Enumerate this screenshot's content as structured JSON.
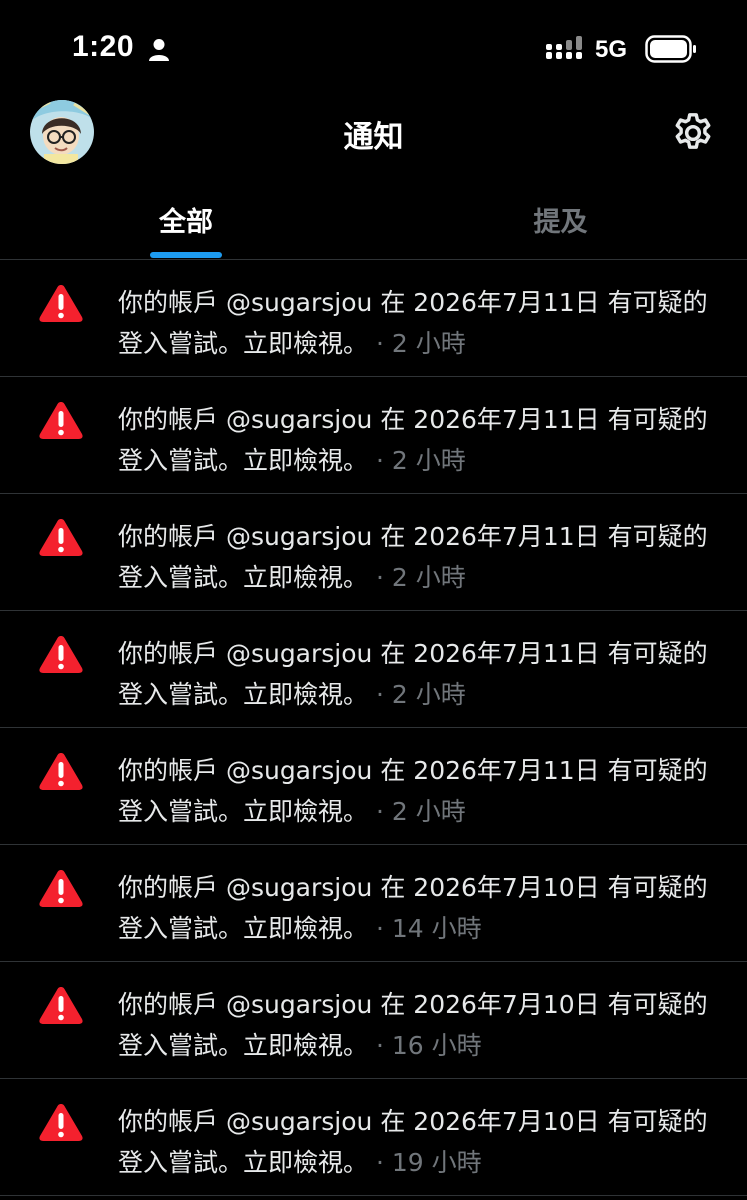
{
  "status_bar": {
    "time": "1:20",
    "network": "5G",
    "icons": [
      "person-icon",
      "signal-icon",
      "battery-icon"
    ]
  },
  "header": {
    "title": "通知",
    "avatar": "avatar",
    "settings_icon": "gear-icon"
  },
  "tabs": [
    {
      "label": "全部",
      "active": true
    },
    {
      "label": "提及",
      "active": false
    }
  ],
  "colors": {
    "background": "#000000",
    "accent": "#1d9bf0",
    "warning": "#f4212e",
    "muted": "#71767b",
    "divider": "#2f3336"
  },
  "notifications": [
    {
      "text": "你的帳戶 @sugarsjou 在 2026年7月11日 有可疑的登入嘗試。立即檢視。",
      "time": "· 2 小時"
    },
    {
      "text": "你的帳戶 @sugarsjou 在 2026年7月11日 有可疑的登入嘗試。立即檢視。",
      "time": "· 2 小時"
    },
    {
      "text": "你的帳戶 @sugarsjou 在 2026年7月11日 有可疑的登入嘗試。立即檢視。",
      "time": "· 2 小時"
    },
    {
      "text": "你的帳戶 @sugarsjou 在 2026年7月11日 有可疑的登入嘗試。立即檢視。",
      "time": "· 2 小時"
    },
    {
      "text": "你的帳戶 @sugarsjou 在 2026年7月11日 有可疑的登入嘗試。立即檢視。",
      "time": "· 2 小時"
    },
    {
      "text": "你的帳戶 @sugarsjou 在 2026年7月10日 有可疑的登入嘗試。立即檢視。",
      "time": "· 14 小時"
    },
    {
      "text": "你的帳戶 @sugarsjou 在 2026年7月10日 有可疑的登入嘗試。立即檢視。",
      "time": "· 16 小時"
    },
    {
      "text": "你的帳戶 @sugarsjou 在 2026年7月10日 有可疑的登入嘗試。立即檢視。",
      "time": "· 19 小時"
    }
  ]
}
